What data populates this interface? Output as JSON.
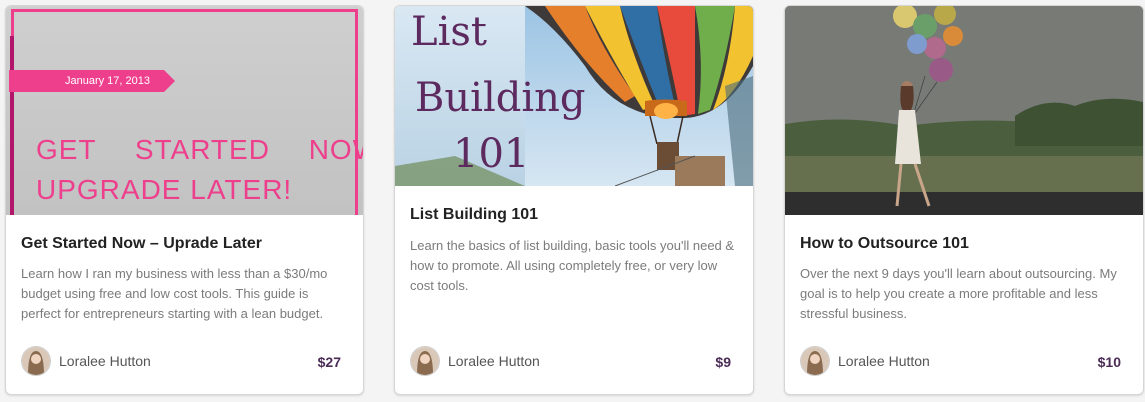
{
  "cards": [
    {
      "image": {
        "date": "January 17, 2013",
        "line1": "GET STARTED NOW!",
        "line2": "UPGRADE LATER!"
      },
      "title": "Get Started Now – Uprade Later",
      "description": "Learn how I ran my business with less than a $30/mo budget using free and low cost tools. This guide is perfect for entrepreneurs starting with a lean budget.",
      "author": "Loralee Hutton",
      "price": "$27"
    },
    {
      "image": {
        "word1": "List",
        "word2": "Building",
        "word3": "101"
      },
      "title": "List Building 101",
      "description": "Learn the basics of list building, basic tools you'll need & how to promote. All using completely free, or very low cost tools.",
      "author": "Loralee Hutton",
      "price": "$9"
    },
    {
      "title": "How to Outsource 101",
      "description": "Over the next 9 days you'll learn about outsourcing. My goal is to help you create a more profitable and less stressful business.",
      "author": "Loralee Hutton",
      "price": "$10"
    }
  ],
  "colors": {
    "accent_pink": "#ee3f8d",
    "price_purple": "#4b2c55",
    "title_purple": "#5d2a5f"
  }
}
